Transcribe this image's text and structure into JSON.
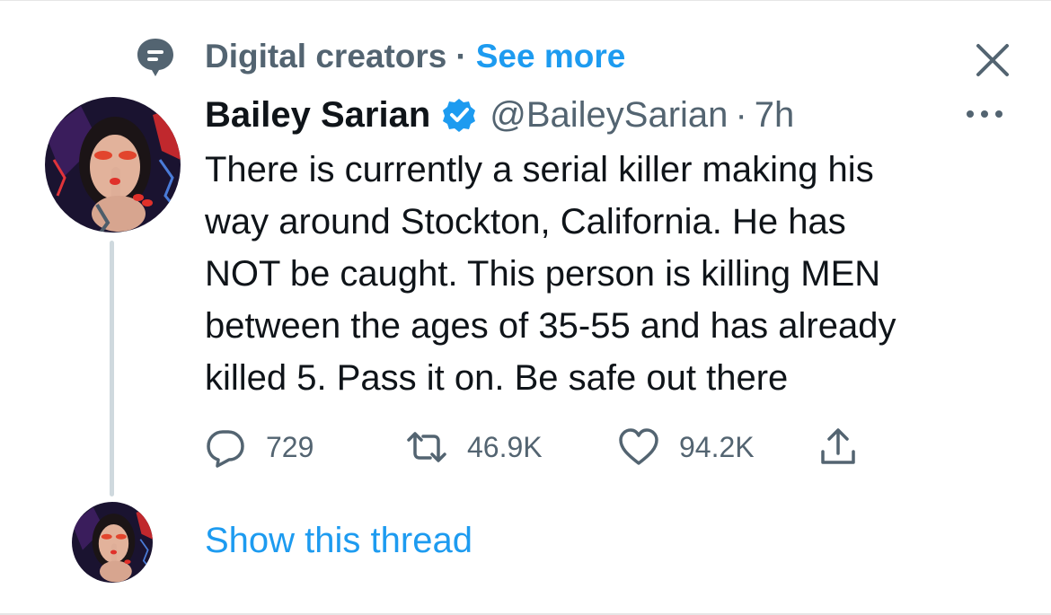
{
  "context": {
    "icon": "topic-bubble-icon",
    "label": "Digital creators",
    "separator": "·",
    "see_more": "See more"
  },
  "tweet": {
    "author_name": "Bailey Sarian",
    "verified_icon": "verified-badge-icon",
    "handle": "@BaileySarian",
    "separator": "·",
    "time": "7h",
    "text": "There is currently a serial killer making his\nway around Stockton, California. He has\nNOT be caught. This person is killing MEN\nbetween the ages of 35-55 and has already\nkilled 5.  Pass it on. Be safe out there",
    "actions": {
      "reply_count": "729",
      "retweet_count": "46.9K",
      "like_count": "94.2K"
    }
  },
  "thread": {
    "show_thread_label": "Show this thread"
  },
  "colors": {
    "accent": "#1d9bf0",
    "secondary_text": "#536471",
    "primary_text": "#0f1419",
    "thread_line": "#cfd9de"
  }
}
